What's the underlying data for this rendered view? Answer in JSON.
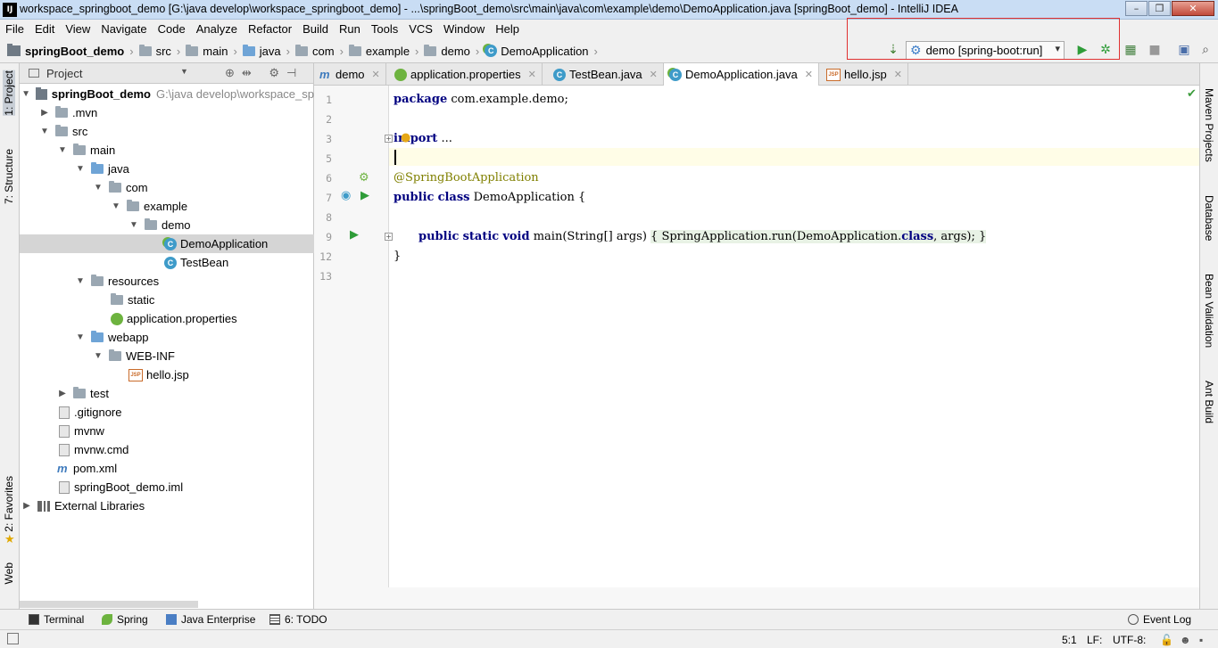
{
  "window": {
    "title": "workspace_springboot_demo [G:\\java develop\\workspace_springboot_demo] - ...\\springBoot_demo\\src\\main\\java\\com\\example\\demo\\DemoApplication.java [springBoot_demo] - IntelliJ IDEA",
    "app_icon_text": "IJ"
  },
  "menu": [
    "File",
    "Edit",
    "View",
    "Navigate",
    "Code",
    "Analyze",
    "Refactor",
    "Build",
    "Run",
    "Tools",
    "VCS",
    "Window",
    "Help"
  ],
  "breadcrumbs": [
    "springBoot_demo",
    "src",
    "main",
    "java",
    "com",
    "example",
    "demo",
    "DemoApplication"
  ],
  "run_config": {
    "label": "demo [spring-boot:run]"
  },
  "left_tabs": {
    "project": "1: Project",
    "structure": "7: Structure",
    "favorites": "2: Favorites",
    "web": "Web"
  },
  "right_tabs": {
    "maven": "Maven Projects",
    "database": "Database",
    "bean": "Bean Validation",
    "ant": "Ant Build"
  },
  "project_panel": {
    "title": "Project",
    "tree": [
      {
        "label": "springBoot_demo",
        "path": "G:\\java develop\\workspace_sp",
        "arrow": "open"
      },
      {
        "label": ".mvn",
        "arrow": "closed"
      },
      {
        "label": "src",
        "arrow": "open"
      },
      {
        "label": "main",
        "arrow": "open"
      },
      {
        "label": "java",
        "arrow": "open"
      },
      {
        "label": "com",
        "arrow": "open"
      },
      {
        "label": "example",
        "arrow": "open"
      },
      {
        "label": "demo",
        "arrow": "open"
      },
      {
        "label": "DemoApplication",
        "arrow": "none"
      },
      {
        "label": "TestBean",
        "arrow": "none"
      },
      {
        "label": "resources",
        "arrow": "open"
      },
      {
        "label": "static",
        "arrow": "none"
      },
      {
        "label": "application.properties",
        "arrow": "none"
      },
      {
        "label": "webapp",
        "arrow": "open"
      },
      {
        "label": "WEB-INF",
        "arrow": "open"
      },
      {
        "label": "hello.jsp",
        "arrow": "none"
      },
      {
        "label": "test",
        "arrow": "closed"
      },
      {
        "label": ".gitignore",
        "arrow": "none"
      },
      {
        "label": "mvnw",
        "arrow": "none"
      },
      {
        "label": "mvnw.cmd",
        "arrow": "none"
      },
      {
        "label": "pom.xml",
        "arrow": "none"
      },
      {
        "label": "springBoot_demo.iml",
        "arrow": "none"
      },
      {
        "label": "External Libraries",
        "arrow": "closed"
      }
    ]
  },
  "editor_tabs": [
    {
      "label": "demo"
    },
    {
      "label": "application.properties"
    },
    {
      "label": "TestBean.java"
    },
    {
      "label": "DemoApplication.java"
    },
    {
      "label": "hello.jsp"
    }
  ],
  "code": {
    "line_numbers": [
      "1",
      "2",
      "3",
      "5",
      "6",
      "7",
      "8",
      "9",
      "12",
      "13"
    ],
    "l1_kw": "package",
    "l1_rest": " com.example.demo;",
    "l3_kw": "import",
    "l3_rest": " ...",
    "l6": "@SpringBootApplication",
    "l7_kw1": "public",
    "l7_kw2": "class",
    "l7_rest": " DemoApplication {",
    "l9_kw1": "public",
    "l9_kw2": "static",
    "l9_kw3": "void",
    "l9_a": " main(String[] args) ",
    "l9_b": "{ SpringApplication.run(DemoApplication.",
    "l9_kw4": "class",
    "l9_c": ", args); }",
    "l12": "}"
  },
  "bottom_tabs": {
    "terminal": "Terminal",
    "spring": "Spring",
    "java_enterprise": "Java Enterprise",
    "todo": "6: TODO",
    "event_log": "Event Log"
  },
  "status": {
    "position": "5:1",
    "line_sep": "LF:",
    "encoding": "UTF-8:"
  }
}
